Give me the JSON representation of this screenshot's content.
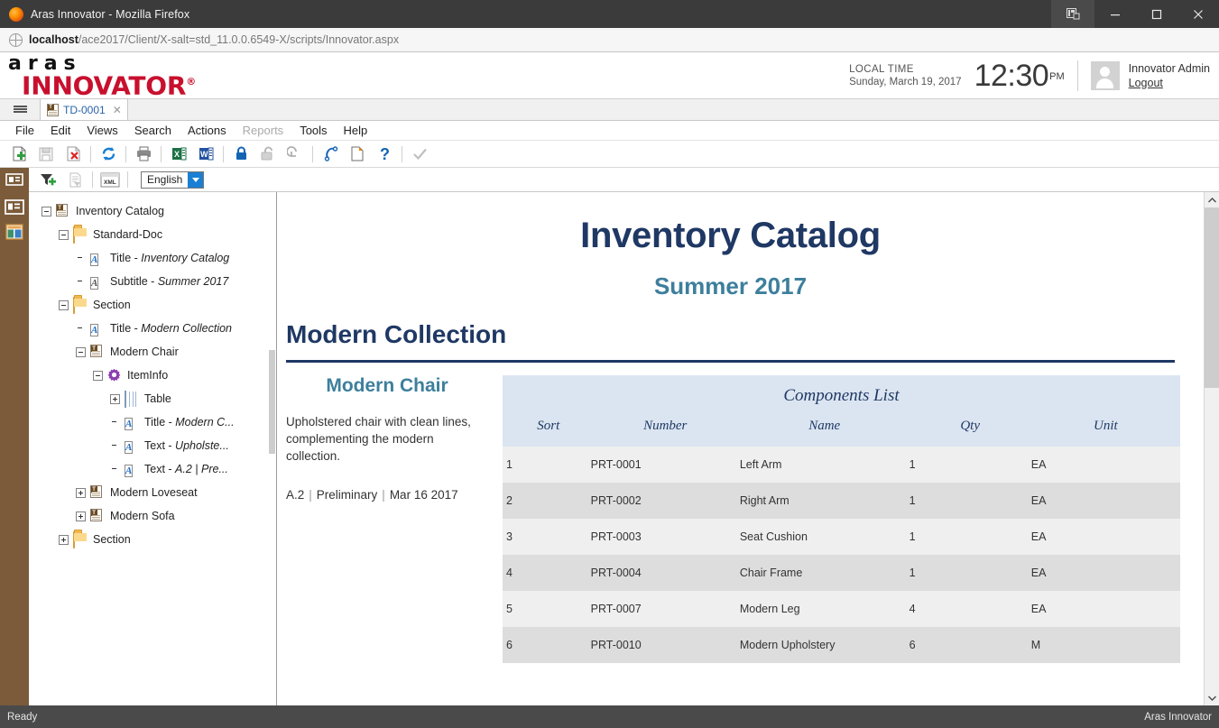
{
  "window": {
    "title": "Aras Innovator - Mozilla Firefox",
    "firefox_icon": "firefox-logo-icon",
    "account_icon": "account-manager-icon",
    "minimize_icon": "minimize-icon",
    "maximize_icon": "maximize-icon",
    "close_icon": "close-icon"
  },
  "urlbar": {
    "globe_icon": "globe-icon",
    "host": "localhost",
    "path": "/ace2017/Client/X-salt=std_11.0.0.6549-X/scripts/Innovator.aspx"
  },
  "header": {
    "logo_top": "aras",
    "logo_bottom": "INNOVATOR",
    "logo_reg": "®",
    "local_time_label": "LOCAL TIME",
    "date": "Sunday, March 19, 2017",
    "clock": "12:30",
    "ampm": "PM",
    "avatar_icon": "user-avatar-icon",
    "user_name": "Innovator Admin",
    "logout_label": "Logout"
  },
  "tabstrip": {
    "menu_icon": "hamburger-menu-icon",
    "tabs": [
      {
        "label": "TD-0001",
        "icon": "document-item-icon",
        "close_icon": "close-tab-icon"
      }
    ]
  },
  "menubar": {
    "items": [
      {
        "label": "File",
        "disabled": false
      },
      {
        "label": "Edit",
        "disabled": false
      },
      {
        "label": "Views",
        "disabled": false
      },
      {
        "label": "Search",
        "disabled": false
      },
      {
        "label": "Actions",
        "disabled": false
      },
      {
        "label": "Reports",
        "disabled": true
      },
      {
        "label": "Tools",
        "disabled": false
      },
      {
        "label": "Help",
        "disabled": false
      }
    ]
  },
  "toolbar": {
    "buttons": [
      {
        "name": "new-item-button",
        "icon": "new-document-plus-icon"
      },
      {
        "name": "save-button",
        "icon": "save-floppy-icon"
      },
      {
        "name": "delete-button",
        "icon": "delete-document-x-icon"
      },
      {
        "name": "refresh-button",
        "icon": "refresh-circular-arrows-icon"
      },
      {
        "name": "print-button",
        "icon": "printer-icon"
      },
      {
        "name": "export-excel-button",
        "icon": "excel-export-icon"
      },
      {
        "name": "export-word-button",
        "icon": "word-export-icon"
      },
      {
        "name": "lock-button",
        "icon": "padlock-closed-icon"
      },
      {
        "name": "unlock-button",
        "icon": "padlock-open-icon"
      },
      {
        "name": "undo-button",
        "icon": "undo-arrow-icon"
      },
      {
        "name": "versions-button",
        "icon": "version-arrow-icon"
      },
      {
        "name": "copy-button",
        "icon": "copy-page-icon"
      },
      {
        "name": "help-button",
        "icon": "question-mark-icon"
      },
      {
        "name": "done-button",
        "icon": "checkmark-icon"
      }
    ]
  },
  "toolbar2": {
    "buttons": [
      {
        "name": "view-mode-button",
        "icon": "panel-view-icon"
      },
      {
        "name": "add-filter-button",
        "icon": "funnel-plus-icon"
      },
      {
        "name": "clear-filter-button",
        "icon": "document-filter-icon"
      },
      {
        "name": "xml-button",
        "icon": "xml-icon"
      }
    ],
    "language_select": {
      "value": "English",
      "arrow_icon": "dropdown-arrow-icon"
    }
  },
  "leftstrip": {
    "icons": [
      {
        "name": "properties-panel-icon"
      },
      {
        "name": "layout-panel-icon"
      }
    ]
  },
  "tree": {
    "nodes": [
      {
        "indent": 0,
        "expander": "minus",
        "icon": "document-item-icon",
        "label": "Inventory Catalog",
        "value": ""
      },
      {
        "indent": 1,
        "expander": "minus",
        "icon": "folder-icon",
        "label": "Standard-Doc",
        "value": ""
      },
      {
        "indent": 2,
        "expander": "none",
        "icon": "text-A-icon",
        "label": "Title - ",
        "value": "Inventory Catalog"
      },
      {
        "indent": 2,
        "expander": "none",
        "icon": "text-A-grey-icon",
        "label": "Subtitle - ",
        "value": "Summer 2017"
      },
      {
        "indent": 1,
        "expander": "minus",
        "icon": "folder-icon",
        "label": "Section",
        "value": ""
      },
      {
        "indent": 2,
        "expander": "none",
        "icon": "text-A-icon",
        "label": "Title - ",
        "value": "Modern Collection"
      },
      {
        "indent": 2,
        "expander": "minus",
        "icon": "document-item-icon",
        "label": "Modern Chair",
        "value": ""
      },
      {
        "indent": 3,
        "expander": "minus",
        "icon": "gear-icon",
        "label": "ItemInfo",
        "value": ""
      },
      {
        "indent": 4,
        "expander": "plus",
        "icon": "table-icon",
        "label": "Table",
        "value": ""
      },
      {
        "indent": 4,
        "expander": "none",
        "icon": "text-A-icon",
        "label": "Title - ",
        "value": "Modern C..."
      },
      {
        "indent": 4,
        "expander": "none",
        "icon": "text-A-icon",
        "label": "Text - ",
        "value": "Upholste..."
      },
      {
        "indent": 4,
        "expander": "none",
        "icon": "text-A-icon",
        "label": "Text - ",
        "value": "A.2 | Pre..."
      },
      {
        "indent": 2,
        "expander": "plus",
        "icon": "document-item-icon",
        "label": "Modern Loveseat",
        "value": ""
      },
      {
        "indent": 2,
        "expander": "plus",
        "icon": "document-item-icon",
        "label": "Modern Sofa",
        "value": ""
      },
      {
        "indent": 1,
        "expander": "plus",
        "icon": "folder-icon",
        "label": "Section",
        "value": ""
      }
    ]
  },
  "document": {
    "title": "Inventory Catalog",
    "subtitle": "Summer 2017",
    "section_title": "Modern Collection",
    "item": {
      "name": "Modern Chair",
      "description": "Upholstered chair with clean lines, complementing the modern collection.",
      "revision": "A.2",
      "state": "Preliminary",
      "date": "Mar 16 2017",
      "separator": "|"
    },
    "table": {
      "caption": "Components List",
      "columns": [
        "Sort",
        "Number",
        "Name",
        "Qty",
        "Unit"
      ],
      "rows": [
        [
          "1",
          "PRT-0001",
          "Left Arm",
          "1",
          "EA"
        ],
        [
          "2",
          "PRT-0002",
          "Right Arm",
          "1",
          "EA"
        ],
        [
          "3",
          "PRT-0003",
          "Seat Cushion",
          "1",
          "EA"
        ],
        [
          "4",
          "PRT-0004",
          "Chair Frame",
          "1",
          "EA"
        ],
        [
          "5",
          "PRT-0007",
          "Modern Leg",
          "4",
          "EA"
        ],
        [
          "6",
          "PRT-0010",
          "Modern Upholstery",
          "6",
          "M"
        ]
      ]
    }
  },
  "scrollbar": {
    "up_icon": "scroll-up-arrow-icon",
    "down_icon": "scroll-down-arrow-icon"
  },
  "statusbar": {
    "left": "Ready",
    "right": "Aras Innovator"
  },
  "colors": {
    "brand_red": "#c8102e",
    "doc_navy": "#1f3864",
    "doc_teal": "#3d7f9c",
    "table_header_bg": "#dbe5f1",
    "sidebar_brown": "#7b5b3a"
  }
}
